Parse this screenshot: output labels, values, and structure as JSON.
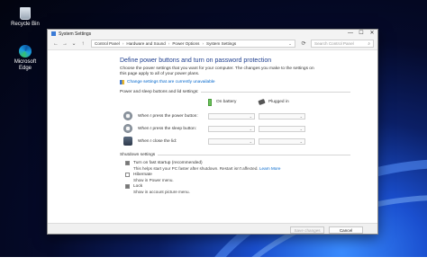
{
  "desktop": {
    "icons": [
      {
        "label": "Recycle Bin",
        "icon": "recycle-bin-icon"
      },
      {
        "label": "Microsoft Edge",
        "icon": "edge-icon"
      }
    ]
  },
  "window": {
    "title": "System Settings",
    "controls": {
      "minimize": "—",
      "maximize": "☐",
      "close": "✕"
    },
    "nav": {
      "back": "←",
      "forward": "→",
      "recent": "⌄",
      "up": "↑"
    },
    "breadcrumb": [
      "Control Panel",
      "Hardware and Sound",
      "Power Options",
      "System Settings"
    ],
    "breadcrumb_sep": "›",
    "search_placeholder": "Search Control Panel",
    "refresh": "⟳"
  },
  "content": {
    "heading": "Define power buttons and turn on password protection",
    "description": "Choose the power settings that you want for your computer. The changes you make to the settings on this page apply to all of your power plans.",
    "change_link": "Change settings that are currently unavailable",
    "power_section_title": "Power and sleep buttons and lid settings:",
    "columns": {
      "battery": "On battery",
      "plugged": "Plugged in"
    },
    "rows": [
      {
        "label": "When I press the power button:",
        "icon": "power-button-icon"
      },
      {
        "label": "When I press the sleep button:",
        "icon": "sleep-button-icon"
      },
      {
        "label": "When I close the lid:",
        "icon": "lid-icon"
      }
    ],
    "dropdown_arrow": "⌄",
    "shutdown_title": "Shutdown settings",
    "shutdown_options": [
      {
        "label": "Turn on fast startup (recommended)",
        "checked": true,
        "sub": "This helps start your PC faster after shutdown. Restart isn't affected.",
        "sub_link": "Learn More"
      },
      {
        "label": "Hibernate",
        "checked": false,
        "sub": "Show in Power menu."
      },
      {
        "label": "Lock",
        "checked": true,
        "sub": "Show in account picture menu."
      }
    ]
  },
  "footer": {
    "save": "Save changes",
    "cancel": "Cancel"
  }
}
